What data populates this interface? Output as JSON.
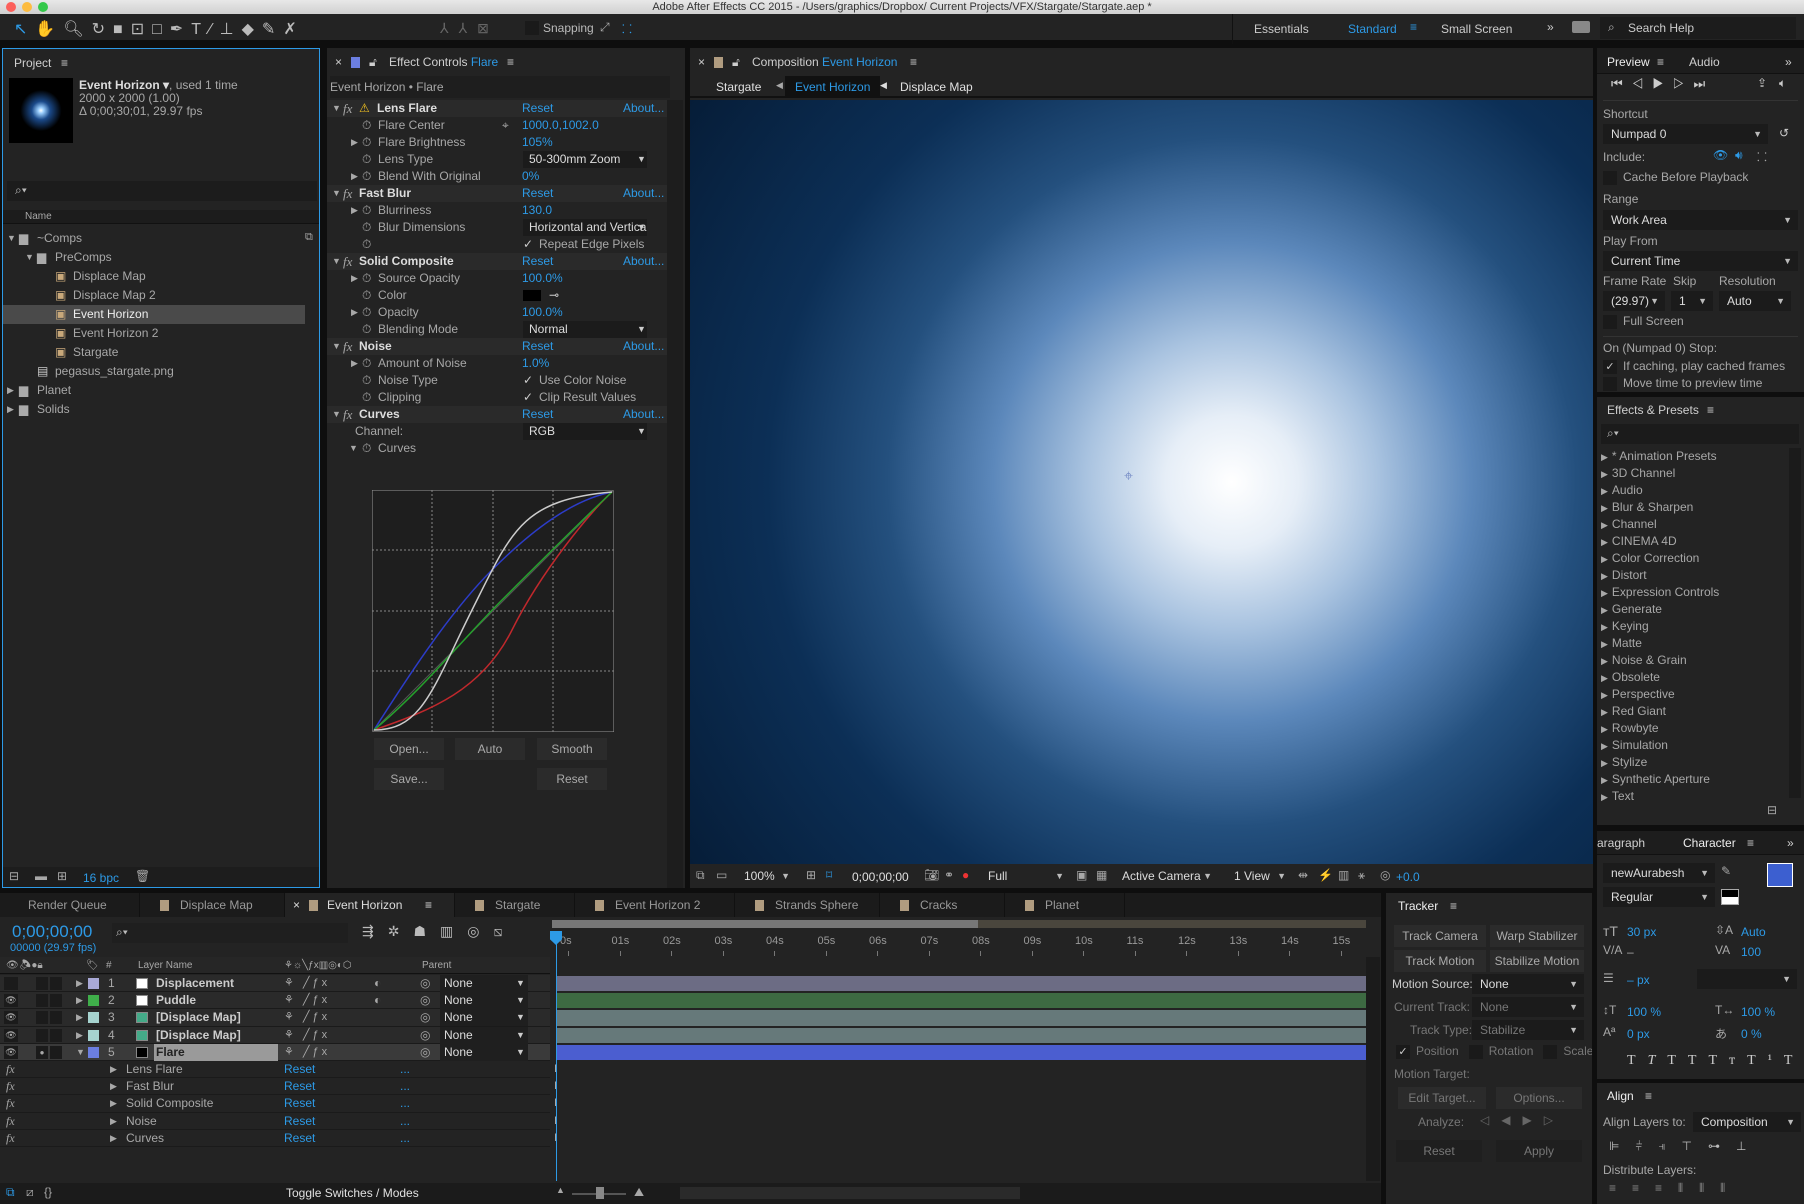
{
  "window": {
    "title": "Adobe After Effects CC 2015 - /Users/graphics/Dropbox/ Current Projects/VFX/Stargate/Stargate.aep *"
  },
  "toolbar": {
    "snapping": "Snapping",
    "workspaces": [
      "Essentials",
      "Standard",
      "Small Screen"
    ],
    "active_workspace": "Standard",
    "search_placeholder": "Search Help",
    "accent": "#2d9ae6"
  },
  "project": {
    "title": "Project",
    "item_name": "Event Horizon ▾",
    "item_usage": ", used 1 time",
    "item_dims": "2000 x 2000 (1.00)",
    "item_duration": "Δ 0;00;30;01, 29.97 fps",
    "column_name": "Name",
    "bpc": "16 bpc",
    "tree": [
      {
        "name": "~Comps",
        "type": "folder",
        "depth": 0,
        "expanded": true
      },
      {
        "name": "PreComps",
        "type": "folder",
        "depth": 1,
        "expanded": true
      },
      {
        "name": "Displace Map",
        "type": "comp",
        "depth": 2
      },
      {
        "name": "Displace Map 2",
        "type": "comp",
        "depth": 2
      },
      {
        "name": "Event Horizon",
        "type": "comp",
        "depth": 2,
        "selected": true
      },
      {
        "name": "Event Horizon 2",
        "type": "comp",
        "depth": 2
      },
      {
        "name": "Stargate",
        "type": "comp",
        "depth": 2
      },
      {
        "name": "pegasus_stargate.png",
        "type": "image",
        "depth": 1
      },
      {
        "name": "Planet",
        "type": "folder",
        "depth": 0,
        "expanded": false
      },
      {
        "name": "Solids",
        "type": "folder",
        "depth": 0,
        "expanded": false
      }
    ]
  },
  "effect_controls": {
    "title": "Effect Controls",
    "layer": "Flare",
    "breadcrumb": "Event Horizon • Flare",
    "rows": [
      {
        "kind": "fx",
        "label": "Lens Flare",
        "warn": true,
        "reset": "Reset",
        "about": "About..."
      },
      {
        "kind": "prop",
        "label": "Flare Center",
        "value": "1000.0,1002.0",
        "target": true
      },
      {
        "kind": "prop",
        "label": "Flare Brightness",
        "value": "105%",
        "twirl": true
      },
      {
        "kind": "prop",
        "label": "Lens Type",
        "dropdown": "50-300mm Zoom"
      },
      {
        "kind": "prop",
        "label": "Blend With Original",
        "value": "0%",
        "twirl": true
      },
      {
        "kind": "fx",
        "label": "Fast Blur",
        "reset": "Reset",
        "about": "About..."
      },
      {
        "kind": "prop",
        "label": "Blurriness",
        "value": "130.0",
        "twirl": true
      },
      {
        "kind": "prop",
        "label": "Blur Dimensions",
        "dropdown": "Horizontal and Vertica"
      },
      {
        "kind": "prop",
        "label": "",
        "check": "Repeat Edge Pixels"
      },
      {
        "kind": "fx",
        "label": "Solid Composite",
        "reset": "Reset",
        "about": "About..."
      },
      {
        "kind": "prop",
        "label": "Source Opacity",
        "value": "100.0%",
        "twirl": true
      },
      {
        "kind": "prop",
        "label": "Color",
        "swatch": "#000000"
      },
      {
        "kind": "prop",
        "label": "Opacity",
        "value": "100.0%",
        "twirl": true
      },
      {
        "kind": "prop",
        "label": "Blending Mode",
        "dropdown": "Normal"
      },
      {
        "kind": "fx",
        "label": "Noise",
        "reset": "Reset",
        "about": "About..."
      },
      {
        "kind": "prop",
        "label": "Amount of Noise",
        "value": "1.0%",
        "twirl": true
      },
      {
        "kind": "prop",
        "label": "Noise Type",
        "check": "Use Color Noise"
      },
      {
        "kind": "prop",
        "label": "Clipping",
        "check": "Clip Result Values"
      },
      {
        "kind": "fx",
        "label": "Curves",
        "reset": "Reset",
        "about": "About..."
      },
      {
        "kind": "plain",
        "label": "Channel:",
        "dropdown": "RGB"
      },
      {
        "kind": "prop",
        "label": "Curves",
        "open": true
      }
    ],
    "curves_buttons": {
      "open": "Open...",
      "auto": "Auto",
      "smooth": "Smooth",
      "save": "Save...",
      "reset": "Reset"
    }
  },
  "composition": {
    "title": "Composition",
    "name": "Event Horizon",
    "crumbs": [
      "Stargate",
      "Event Horizon",
      "Displace Map"
    ],
    "zoom": "100%",
    "time": "0;00;00;00",
    "resolution": "Full",
    "camera": "Active Camera",
    "views": "1 View",
    "exposure": "+0.0"
  },
  "preview": {
    "tabs": [
      "Preview",
      "Audio"
    ],
    "shortcut_label": "Shortcut",
    "shortcut": "Numpad 0",
    "include": "Include:",
    "cache": "Cache Before Playback",
    "range_label": "Range",
    "range": "Work Area",
    "play_from_label": "Play From",
    "play_from": "Current Time",
    "frame_rate_label": "Frame Rate",
    "skip_label": "Skip",
    "resolution_label": "Resolution",
    "frame_rate": "(29.97)",
    "skip": "1",
    "resolution": "Auto",
    "full_screen": "Full Screen",
    "stop_label": "On (Numpad 0) Stop:",
    "if_caching": "If caching, play cached frames",
    "move_time": "Move time to preview time"
  },
  "effects_presets": {
    "title": "Effects & Presets",
    "items": [
      "* Animation Presets",
      "3D Channel",
      "Audio",
      "Blur & Sharpen",
      "Channel",
      "CINEMA 4D",
      "Color Correction",
      "Distort",
      "Expression Controls",
      "Generate",
      "Keying",
      "Matte",
      "Noise & Grain",
      "Obsolete",
      "Perspective",
      "Red Giant",
      "Rowbyte",
      "Simulation",
      "Stylize",
      "Synthetic Aperture",
      "Text"
    ]
  },
  "character": {
    "tabs": [
      "aragraph",
      "Character"
    ],
    "font": "newAurabesh",
    "style": "Regular",
    "size": "30 px",
    "leading": "Auto",
    "kerning": "–",
    "tracking": "100",
    "stroke": "– px",
    "vscale": "100 %",
    "hscale": "100 %",
    "baseline": "0 px",
    "tsume": "0 %",
    "fill_color": "#3c5fd0"
  },
  "align": {
    "title": "Align",
    "align_to_label": "Align Layers to:",
    "align_to": "Composition",
    "distribute_label": "Distribute Layers:"
  },
  "timeline": {
    "tabs": [
      "Render Queue",
      "Displace Map",
      "Event Horizon",
      "Stargate",
      "Event Horizon 2",
      "Strands Sphere",
      "Cracks",
      "Planet"
    ],
    "active_tab": "Event Horizon",
    "time": "0;00;00;00",
    "frames": "00000 (29.97 fps)",
    "col_num": "#",
    "col_layer": "Layer Name",
    "col_parent": "Parent",
    "layers": [
      {
        "num": "1",
        "name": "Displacement",
        "label_color": "#a9a9d6",
        "bar_color": "#6c6c84",
        "parent": "None"
      },
      {
        "num": "2",
        "name": "Puddle",
        "label_color": "#3fae4a",
        "bar_color": "#3d6a42",
        "parent": "None"
      },
      {
        "num": "3",
        "name": "[Displace Map]",
        "label_color": "#a6d3cf",
        "bar_color": "#66797a",
        "parent": "None"
      },
      {
        "num": "4",
        "name": "[Displace Map]",
        "label_color": "#a6d3cf",
        "bar_color": "#66797a",
        "parent": "None"
      },
      {
        "num": "5",
        "name": "Flare",
        "label_color": "#6b7ee0",
        "bar_color": "#4b5ed0",
        "parent": "None",
        "selected": true
      }
    ],
    "effects": [
      {
        "name": "Lens Flare",
        "reset": "Reset"
      },
      {
        "name": "Fast Blur",
        "reset": "Reset"
      },
      {
        "name": "Solid Composite",
        "reset": "Reset"
      },
      {
        "name": "Noise",
        "reset": "Reset"
      },
      {
        "name": "Curves",
        "reset": "Reset"
      }
    ],
    "ruler": [
      "0s",
      "01s",
      "02s",
      "03s",
      "04s",
      "05s",
      "06s",
      "07s",
      "08s",
      "09s",
      "10s",
      "11s",
      "12s",
      "13s",
      "14s",
      "15s"
    ],
    "work_area_end_s": 8,
    "toggle": "Toggle Switches / Modes"
  },
  "tracker": {
    "title": "Tracker",
    "track_camera": "Track Camera",
    "warp": "Warp Stabilizer",
    "track_motion": "Track Motion",
    "stabilize": "Stabilize Motion",
    "motion_source_label": "Motion Source:",
    "motion_source": "None",
    "current_track_label": "Current Track:",
    "current_track": "None",
    "track_type_label": "Track Type:",
    "track_type": "Stabilize",
    "position": "Position",
    "rotation": "Rotation",
    "scale": "Scale",
    "motion_target": "Motion Target:",
    "edit_target": "Edit Target...",
    "options": "Options...",
    "analyze": "Analyze:",
    "reset": "Reset",
    "apply": "Apply"
  }
}
